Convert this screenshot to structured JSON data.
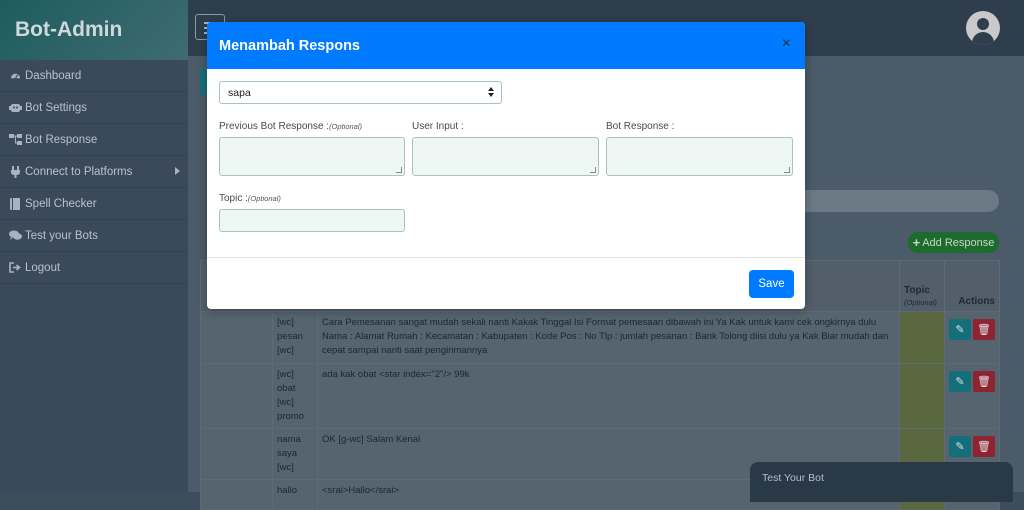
{
  "brand": "Bot-Admin",
  "sidebar": {
    "items": [
      {
        "label": "Dashboard",
        "icon": "dashboard-icon"
      },
      {
        "label": "Bot Settings",
        "icon": "robot-icon"
      },
      {
        "label": "Bot Response",
        "icon": "sitemap-icon"
      },
      {
        "label": "Connect to Platforms",
        "icon": "plug-icon"
      },
      {
        "label": "Spell Checker",
        "icon": "book-icon"
      },
      {
        "label": "Test your Bots",
        "icon": "comments-icon"
      },
      {
        "label": "Logout",
        "icon": "sign-out-icon"
      }
    ]
  },
  "header": {
    "menu_icon": "hamburger-icon",
    "user_icon": "user-circle-icon"
  },
  "background": {
    "add_button": "Add Response",
    "table": {
      "headers": {
        "topic": "Topic",
        "topic_note": "(Optional)",
        "actions": "Actions"
      },
      "rows": [
        {
          "input": "[wc] pesan [wc]",
          "response": "Cara Pemesanan sangat mudah sekali nanti Kakak Tinggal Isi Format pemesaan dibawah ini Ya Kak untuk kami cek ongkirnya dulu Nama : Alamat Rumah : Kecamatan : Kabupaten : Kode Pos : No Tlp : jumlah pesanan : Bank Tolong diisi dulu ya Kak Biar mudah dan cepat sampai nanti saat pengirimannya"
        },
        {
          "input": "[wc] obat [wc] promo",
          "response": "ada kak obat <star index=\"2\"/> 99k"
        },
        {
          "input": "nama saya [wc]",
          "response": "OK [g-wc] Salam Kenal"
        },
        {
          "input": "hallo",
          "response": "<srai>Hallo</srai>"
        }
      ]
    },
    "test_bot": "Test Your Bot"
  },
  "modal": {
    "title": "Menambah Respons",
    "close": "×",
    "select_value": "sapa",
    "fields": {
      "prev_label": "Previous Bot Response :",
      "prev_note": "(Optional)",
      "user_label": "User Input :",
      "bot_label": "Bot Response :",
      "topic_label": "Topic :",
      "topic_note": "(Optional)"
    },
    "save": "Save"
  },
  "colors": {
    "primary": "#007bff",
    "sidebar": "#3a4a5a",
    "add_green": "#28a745"
  }
}
